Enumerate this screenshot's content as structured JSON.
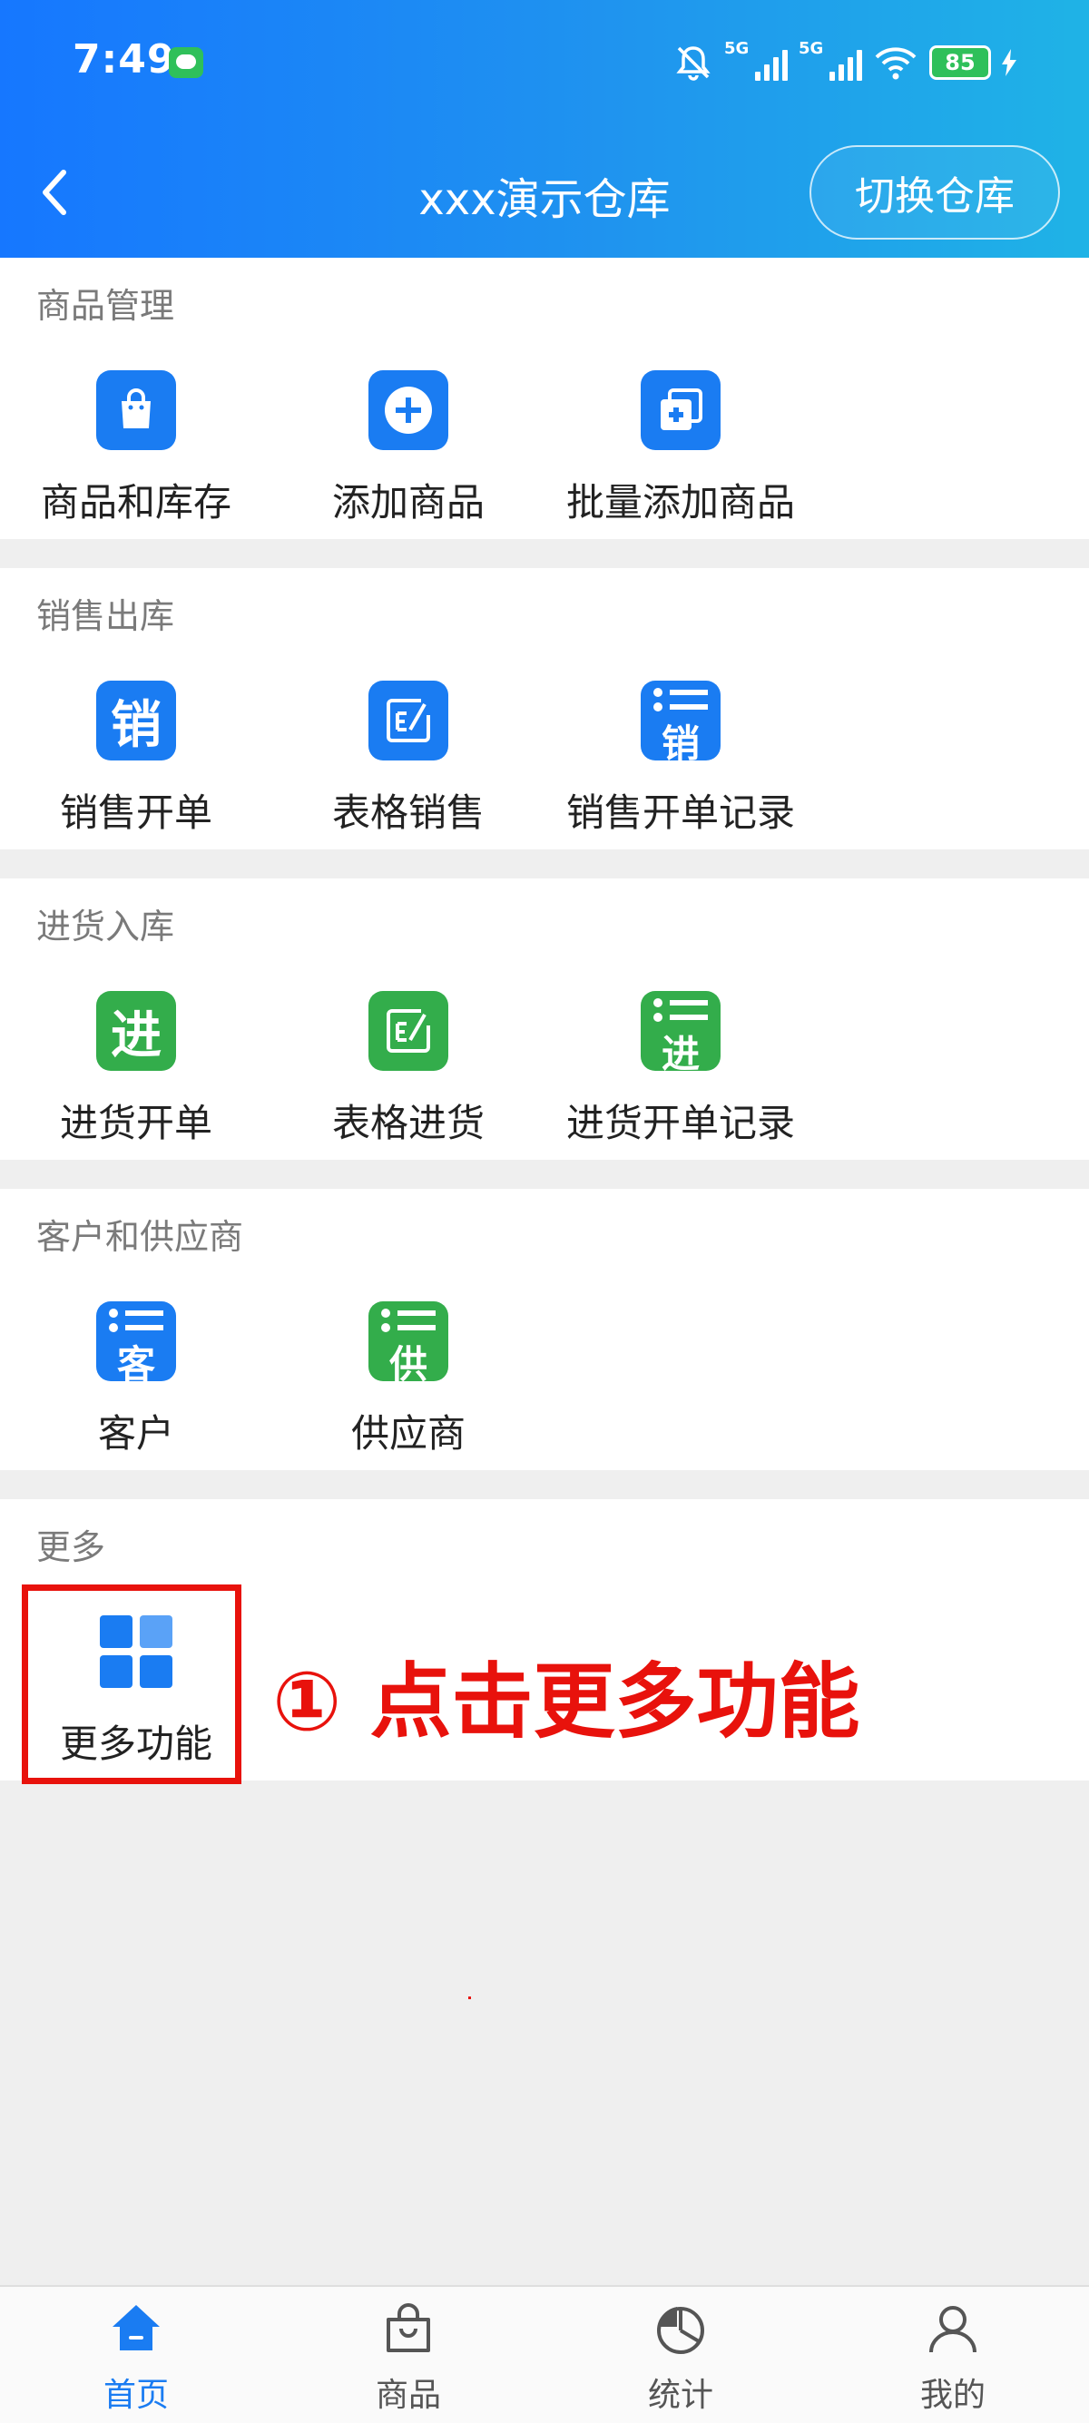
{
  "status_bar": {
    "time": "7:49",
    "signal1_label": "5G",
    "signal2_label": "5G",
    "battery": "85"
  },
  "nav": {
    "title": "xxx演示仓库",
    "switch_label": "切换仓库"
  },
  "sections": [
    {
      "title": "商品管理",
      "items": [
        {
          "label": "商品和库存",
          "icon": "shopping-bag-icon",
          "color": "#1a7cf2"
        },
        {
          "label": "添加商品",
          "icon": "plus-circle-icon",
          "color": "#1a7cf2"
        },
        {
          "label": "批量添加商品",
          "icon": "batch-add-icon",
          "color": "#1a7cf2"
        }
      ]
    },
    {
      "title": "销售出库",
      "items": [
        {
          "label": "销售开单",
          "icon": "sale-order-icon",
          "glyph": "销",
          "color": "#1a7cf2"
        },
        {
          "label": "表格销售",
          "icon": "table-edit-icon",
          "color": "#1a7cf2"
        },
        {
          "label": "销售开单记录",
          "icon": "sale-record-icon",
          "glyph": "销",
          "color": "#1a7cf2"
        }
      ]
    },
    {
      "title": "进货入库",
      "items": [
        {
          "label": "进货开单",
          "icon": "purchase-order-icon",
          "glyph": "进",
          "color": "#33ad4b"
        },
        {
          "label": "表格进货",
          "icon": "table-edit-icon",
          "color": "#33ad4b"
        },
        {
          "label": "进货开单记录",
          "icon": "purchase-record-icon",
          "glyph": "进",
          "color": "#33ad4b"
        }
      ]
    },
    {
      "title": "客户和供应商",
      "items": [
        {
          "label": "客户",
          "icon": "customer-list-icon",
          "glyph": "客",
          "color": "#1a7cf2"
        },
        {
          "label": "供应商",
          "icon": "supplier-list-icon",
          "glyph": "供",
          "color": "#33ad4b"
        }
      ]
    },
    {
      "title": "更多",
      "items": [
        {
          "label": "更多功能",
          "icon": "grid-icon",
          "color": "#1a7cf2"
        }
      ]
    }
  ],
  "annotation": {
    "text": "① 点击更多功能",
    "color": "#e8120c"
  },
  "tabbar": {
    "tabs": [
      {
        "label": "首页",
        "icon": "home-icon",
        "active": true
      },
      {
        "label": "商品",
        "icon": "bag-icon",
        "active": false
      },
      {
        "label": "统计",
        "icon": "pie-chart-icon",
        "active": false
      },
      {
        "label": "我的",
        "icon": "user-icon",
        "active": false
      }
    ],
    "active_color": "#1a7cf2"
  }
}
